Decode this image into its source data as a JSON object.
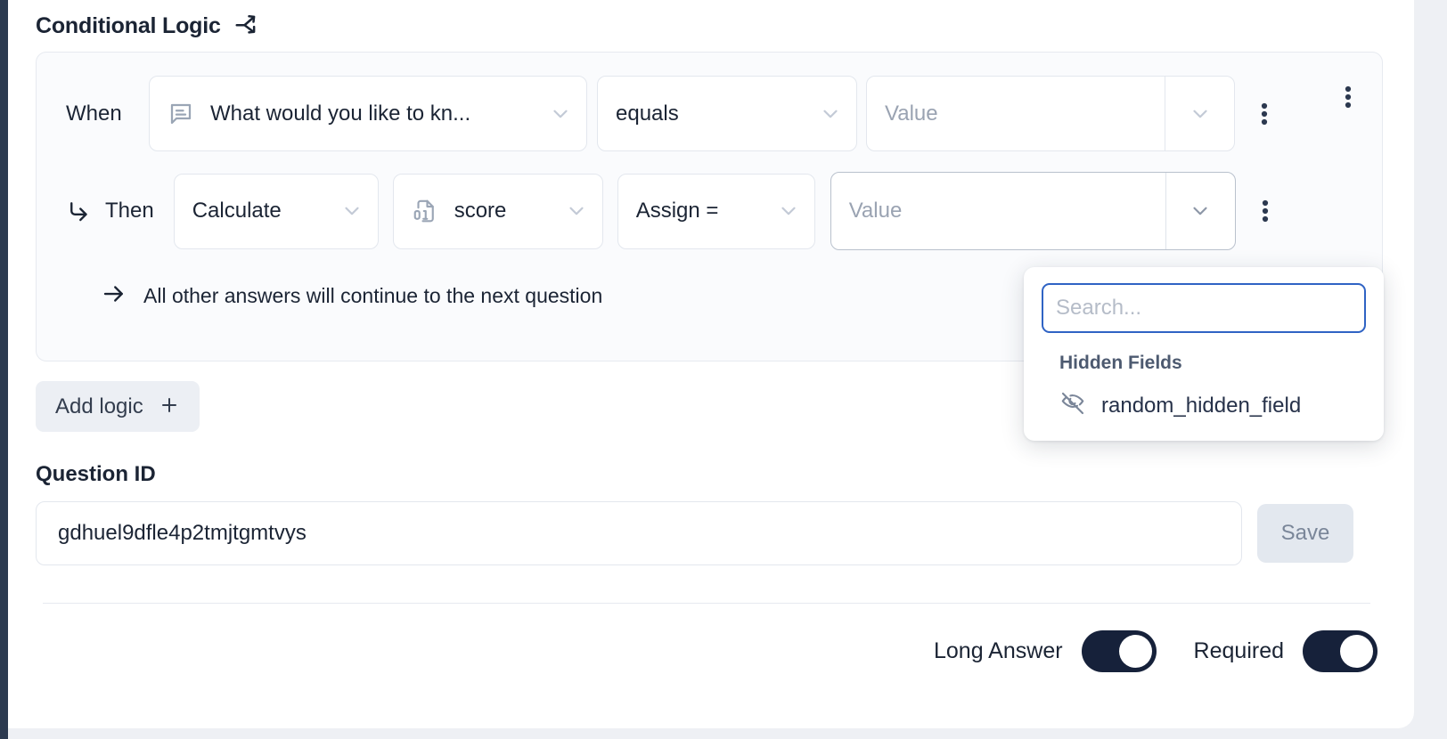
{
  "section": {
    "title": "Conditional Logic",
    "icon": "branch-arrows-icon"
  },
  "logic": {
    "when": {
      "label": "When",
      "question": {
        "icon": "message-square-text-icon",
        "value": "What would you like to kn...",
        "chevron": "chevron-down-icon"
      },
      "operator": {
        "value": "equals",
        "chevron": "chevron-down-icon"
      },
      "value": {
        "placeholder": "Value",
        "chevron": "chevron-down-icon"
      },
      "menu_icon": "more-vertical-icon"
    },
    "then": {
      "arrow_icon": "corner-down-right-arrow-icon",
      "label": "Then",
      "action": {
        "value": "Calculate",
        "chevron": "chevron-down-icon"
      },
      "variable": {
        "icon": "file-digit-icon",
        "value": "score",
        "chevron": "chevron-down-icon"
      },
      "operation": {
        "value": "Assign =",
        "chevron": "chevron-down-icon"
      },
      "value": {
        "placeholder": "Value",
        "chevron": "chevron-down-icon"
      },
      "menu_icon": "more-vertical-icon"
    },
    "fallback": {
      "arrow_icon": "arrow-right-icon",
      "text": "All other answers will continue to the next question"
    },
    "panel_menu_icon": "more-vertical-icon"
  },
  "add_logic": {
    "label": "Add logic",
    "icon": "plus-icon"
  },
  "question_id": {
    "label": "Question ID",
    "value": "gdhuel9dfle4p2tmjtgmtvys",
    "placeholder": "Question ID",
    "save_label": "Save"
  },
  "footer": {
    "long_answer": {
      "label": "Long Answer",
      "state": "on"
    },
    "required": {
      "label": "Required",
      "state": "on"
    }
  },
  "dropdown": {
    "search_placeholder": "Search...",
    "search_value": "",
    "group_title": "Hidden Fields",
    "items": [
      {
        "label": "random_hidden_field",
        "icon": "eye-off-icon"
      }
    ]
  },
  "colors": {
    "accent_focus": "#2f63c4",
    "toggle_on": "#16213a",
    "rail": "#2c3a50",
    "panel_bg": "#fafbfd",
    "border": "#e3e7ee"
  }
}
